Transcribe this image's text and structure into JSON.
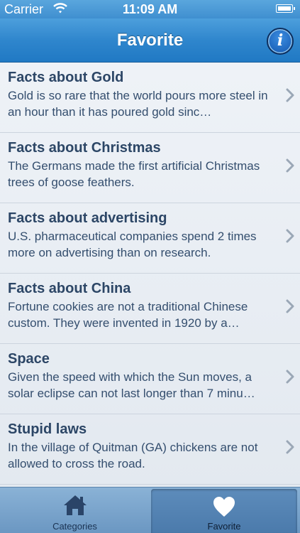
{
  "status_bar": {
    "carrier": "Carrier",
    "time": "11:09 AM"
  },
  "nav": {
    "title": "Favorite",
    "info_label": "i"
  },
  "items": [
    {
      "title": "Facts about Gold",
      "description": "Gold is so rare that the world pours more steel in an hour than it has poured gold sinc…"
    },
    {
      "title": "Facts about Christmas",
      "description": "The Germans made the first artificial Christmas trees of goose feathers."
    },
    {
      "title": "Facts about advertising",
      "description": "U.S. pharmaceutical companies spend 2 times more on advertising than on research."
    },
    {
      "title": "Facts about China",
      "description": "Fortune cookies are not a traditional Chinese custom. They were invented in 1920 by a…"
    },
    {
      "title": "Space",
      "description": "Given the speed with which the Sun moves, a solar eclipse can not last longer than 7 minu…"
    },
    {
      "title": "Stupid laws",
      "description": "In the village of Quitman (GA) chickens are not allowed to cross the road."
    }
  ],
  "tabs": {
    "categories": {
      "label": "Categories",
      "icon": "house-icon"
    },
    "favorite": {
      "label": "Favorite",
      "icon": "heart-icon",
      "selected": true
    }
  },
  "colors": {
    "nav_blue": "#2f86cd",
    "title_text": "#2c4666",
    "tab_bar": "#7aa4cc"
  }
}
